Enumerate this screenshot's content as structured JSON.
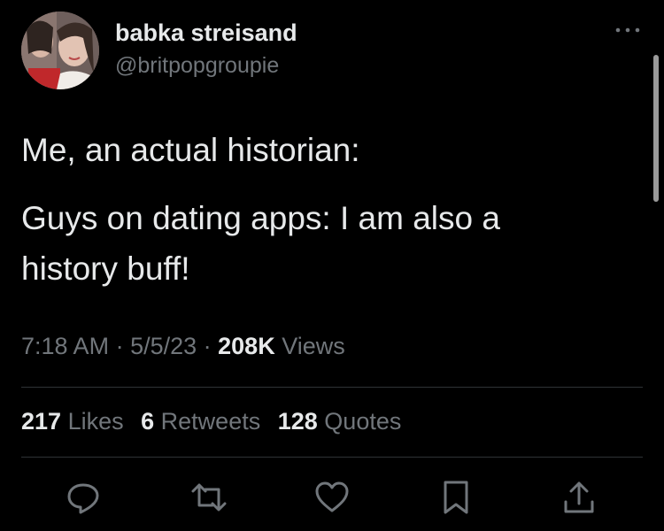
{
  "author": {
    "display_name": "babka streisand",
    "handle": "@britpopgroupie"
  },
  "tweet": {
    "lines": [
      "Me, an actual historian:",
      "Guys on dating apps: I am also a",
      "history buff!"
    ]
  },
  "meta": {
    "time": "7:18 AM",
    "sep1": " · ",
    "date": "5/5/23",
    "sep2": " · ",
    "views_count": "208K",
    "views_label": " Views"
  },
  "stats": {
    "likes_count": "217",
    "likes_label": " Likes",
    "retweets_count": "6",
    "retweets_label": " Retweets",
    "quotes_count": "128",
    "quotes_label": " Quotes"
  },
  "icons": {
    "more": "more-icon",
    "reply": "reply-icon",
    "retweet": "retweet-icon",
    "like": "heart-icon",
    "bookmark": "bookmark-icon",
    "share": "share-icon"
  },
  "colors": {
    "background": "#000000",
    "text_primary": "#e7e9ea",
    "text_secondary": "#71767b",
    "divider": "#2f3336"
  }
}
